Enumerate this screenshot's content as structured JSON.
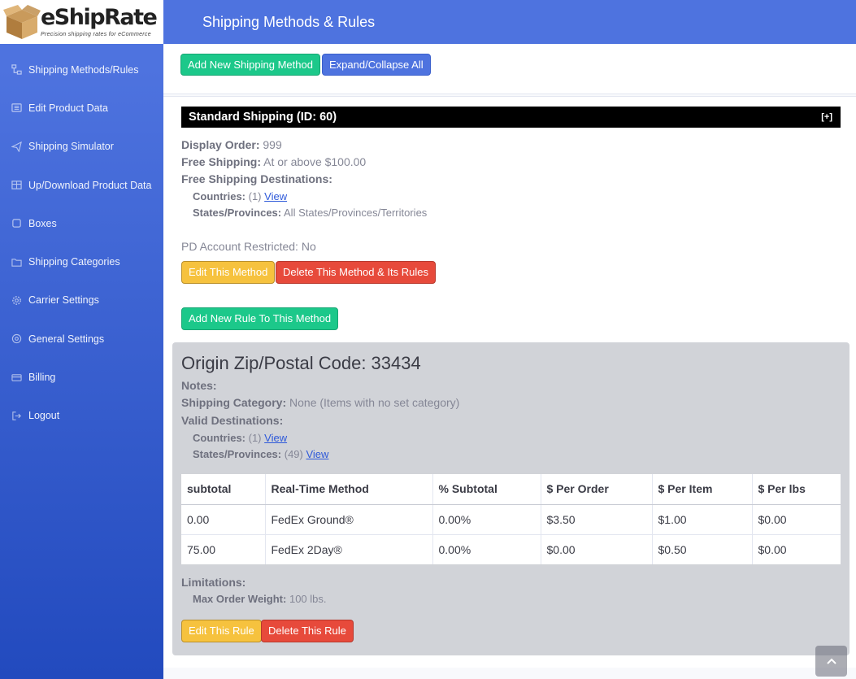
{
  "brand": {
    "name": "eShipRate",
    "tagline": "Precision shipping rates for eCommerce"
  },
  "header": {
    "title": "Shipping Methods & Rules"
  },
  "sidebar": {
    "items": [
      {
        "label": "Shipping Methods/Rules",
        "icon": "sitemap-icon"
      },
      {
        "label": "Edit Product Data",
        "icon": "list-icon"
      },
      {
        "label": "Shipping Simulator",
        "icon": "paper-plane-icon"
      },
      {
        "label": "Up/Download Product Data",
        "icon": "table-icon"
      },
      {
        "label": "Boxes",
        "icon": "square-icon"
      },
      {
        "label": "Shipping Categories",
        "icon": "folder-icon"
      },
      {
        "label": "Carrier Settings",
        "icon": "gear-icon"
      },
      {
        "label": "General Settings",
        "icon": "cogs-icon"
      },
      {
        "label": "Billing",
        "icon": "credit-card-icon"
      },
      {
        "label": "Logout",
        "icon": "sign-out-icon"
      }
    ]
  },
  "toolbar": {
    "add_method_label": "Add New Shipping Method",
    "expand_label": "Expand/Collapse All"
  },
  "method": {
    "header": "Standard Shipping (ID: 60)",
    "toggle": "[+]",
    "display_order_label": "Display Order:",
    "display_order": "999",
    "free_shipping_label": "Free Shipping:",
    "free_shipping": "At or above $100.00",
    "free_dest_label": "Free Shipping Destinations:",
    "countries_label": "Countries:",
    "countries_count": "(1)",
    "view_label": "View",
    "states_label": "States/Provinces:",
    "states_value": "All States/Provinces/Territories",
    "pd_restricted": "PD Account Restricted: No",
    "edit_label": "Edit This Method",
    "delete_label": "Delete This Method & Its Rules",
    "add_rule_label": "Add New Rule To This Method"
  },
  "rule": {
    "title": "Origin Zip/Postal Code: 33434",
    "notes_label": "Notes:",
    "category_label": "Shipping Category:",
    "category_value": "None (Items with no set category)",
    "valid_dest_label": "Valid Destinations:",
    "countries_label": "Countries:",
    "countries_count": "(1)",
    "states_label": "States/Provinces:",
    "states_count": "(49)",
    "view_label": "View",
    "table": {
      "headers": [
        "subtotal",
        "Real-Time Method",
        "% Subtotal",
        "$ Per Order",
        "$ Per Item",
        "$ Per lbs"
      ],
      "rows": [
        [
          "0.00",
          "FedEx Ground®",
          "0.00%",
          "$3.50",
          "$1.00",
          "$0.00"
        ],
        [
          "75.00",
          "FedEx 2Day®",
          "0.00%",
          "$0.00",
          "$0.50",
          "$0.00"
        ]
      ]
    },
    "limitations_label": "Limitations:",
    "max_weight_label": "Max Order Weight:",
    "max_weight_value": "100 lbs.",
    "edit_label": "Edit This Rule",
    "delete_label": "Delete This Rule"
  },
  "colors": {
    "primary": "#4e73df",
    "success": "#1cc88a",
    "warning": "#f6c23e",
    "danger": "#e74a3b"
  }
}
